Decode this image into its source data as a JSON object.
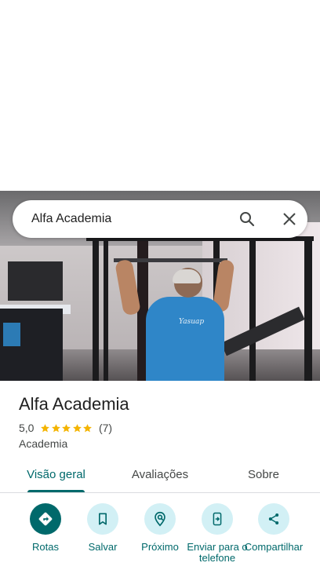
{
  "search": {
    "value": "Alfa Academia"
  },
  "hero": {
    "logo_text": "Yasuap"
  },
  "place": {
    "name": "Alfa Academia",
    "rating": "5,0",
    "stars": 5,
    "review_count": "(7)",
    "category": "Academia"
  },
  "tabs": [
    {
      "label": "Visão geral",
      "active": true
    },
    {
      "label": "Avaliações",
      "active": false
    },
    {
      "label": "Sobre",
      "active": false
    }
  ],
  "actions": [
    {
      "label": "Rotas",
      "icon": "directions-icon"
    },
    {
      "label": "Salvar",
      "icon": "bookmark-icon"
    },
    {
      "label": "Próximo",
      "icon": "nearby-icon"
    },
    {
      "label": "Enviar para o telefone",
      "icon": "send-to-phone-icon"
    },
    {
      "label": "Compartilhar",
      "icon": "share-icon"
    }
  ],
  "colors": {
    "accent": "#00696b",
    "action_bg": "#d2f0f5",
    "star": "#f4b400",
    "person_shirt": "#2f86c8"
  }
}
